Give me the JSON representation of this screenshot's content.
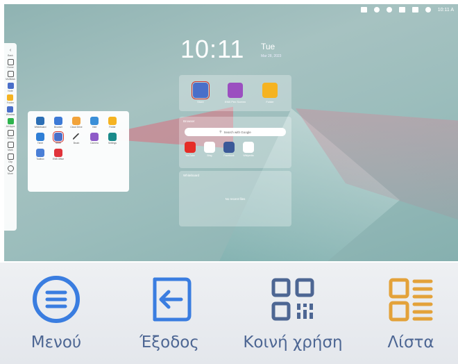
{
  "status_bar": {
    "time": "10:11 A"
  },
  "clock": {
    "time": "10:11",
    "day": "Tue",
    "date": "Mar 28, 2023"
  },
  "sidebar": {
    "items": [
      {
        "label": "Back",
        "icon": "chevron-left-icon"
      },
      {
        "label": "Home",
        "icon": "home-icon"
      },
      {
        "label": "Multitask",
        "icon": "multitask-icon"
      },
      {
        "label": "Note",
        "icon": "note-icon"
      },
      {
        "label": "Folder",
        "icon": "folder-icon"
      },
      {
        "label": "Window",
        "icon": "window-icon"
      },
      {
        "label": "All Apps",
        "icon": "apps-grid-icon"
      },
      {
        "label": "Share",
        "icon": "share-icon"
      },
      {
        "label": "Mark",
        "icon": "pen-icon"
      },
      {
        "label": "Clip",
        "icon": "crop-icon"
      },
      {
        "label": "More",
        "icon": "more-icon"
      }
    ]
  },
  "drawer": {
    "apps": [
      {
        "label": "Whiteboard",
        "color": "#2c6fb5"
      },
      {
        "label": "Browser",
        "color": "#3d7ad6"
      },
      {
        "label": "Cloud Drive",
        "color": "#f2a33a"
      },
      {
        "label": "Vote",
        "color": "#3a8fd8"
      },
      {
        "label": "Folder",
        "color": "#f5b321"
      },
      {
        "label": "Timer",
        "color": "#2f7fd6"
      },
      {
        "label": "Store",
        "color": "#4a6fc9"
      },
      {
        "label": "Brush",
        "color": "#444"
      },
      {
        "label": "Camera",
        "color": "#8e5bc8"
      },
      {
        "label": "Settings",
        "color": "#1a8a8a"
      },
      {
        "label": "Toolbox",
        "color": "#4a7fd6"
      },
      {
        "label": "ENB Office",
        "color": "#e0343b"
      }
    ]
  },
  "widgets": {
    "top_apps": [
      {
        "label": "Store",
        "color": "#4a6fc9"
      },
      {
        "label": "ENB Pen Screen",
        "color": "#9b4fc0"
      },
      {
        "label": "Folder",
        "color": "#f5b321"
      }
    ],
    "browser_title": "Browser",
    "search_placeholder": "Search with Google",
    "favorites": [
      {
        "label": "YouTube",
        "color": "#e52d27"
      },
      {
        "label": "Bing",
        "color": "#ffffff"
      },
      {
        "label": "Facebook",
        "color": "#3b5998"
      },
      {
        "label": "Wikipedia",
        "color": "#ffffff"
      }
    ],
    "notes_title": "Whiteboard",
    "notes_empty": "No recent files"
  },
  "toolbar": {
    "menu_label": "Μενού",
    "exit_label": "Έξοδος",
    "share_label": "Κοινή χρήση",
    "list_label": "Λίστα",
    "colors": {
      "blue": "#3a7de0",
      "navy": "#4d6693",
      "orange": "#e3a23a",
      "text": "#4d6693"
    }
  }
}
